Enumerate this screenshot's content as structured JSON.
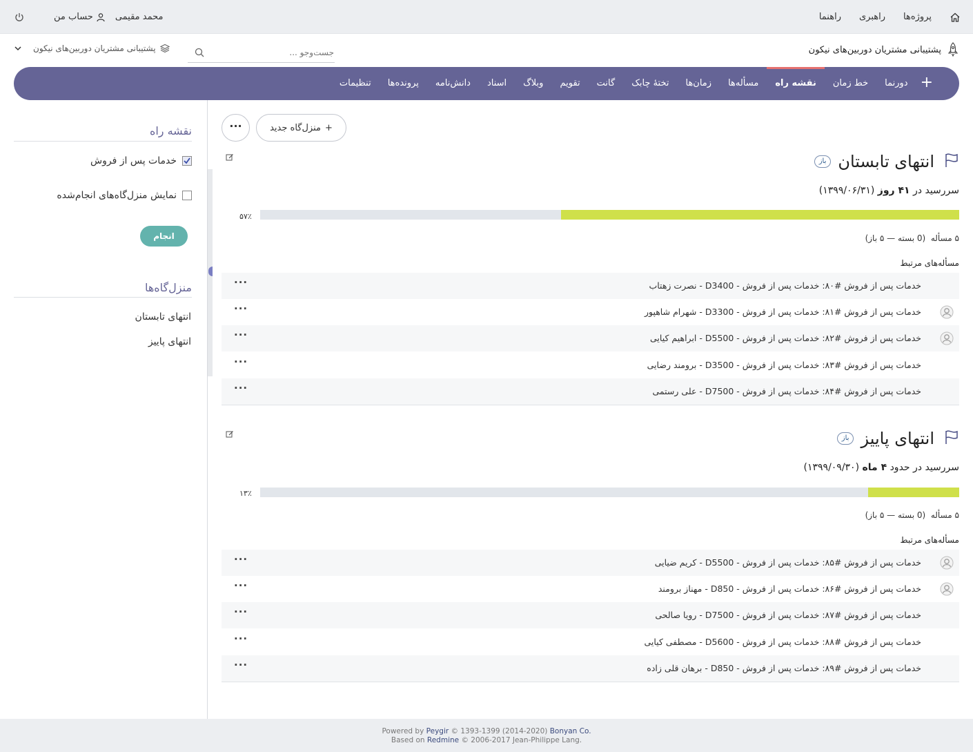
{
  "topbar": {
    "nav": [
      "پروژه‌ها",
      "راهبری",
      "راهنما"
    ],
    "user_name": "محمد مقیمی",
    "my_account": "حساب من"
  },
  "project": {
    "title": "پشتیبانی مشتریان دوربین‌های نیکون"
  },
  "search": {
    "placeholder": "جست‌وجو ..."
  },
  "project_jump": {
    "label": "پشتیبانی مشتریان دوربین‌های نیکون"
  },
  "menu": {
    "tabs": [
      "دورنما",
      "خط زمان",
      "نقشه راه",
      "مسأله‌ها",
      "زمان‌ها",
      "تختهٔ چابک",
      "گانت",
      "تقویم",
      "وبلاگ",
      "اسناد",
      "دانش‌نامه",
      "پرونده‌ها",
      "تنظیمات"
    ],
    "selected": "نقشه راه"
  },
  "sidebar": {
    "title": "نقشه راه",
    "tracker_label": "خدمات پس از فروش",
    "show_completed_label": "نمایش منزل‌گاه‌های انجام‌شده",
    "apply_label": "انجام",
    "milestones_title": "منزل‌گاه‌ها",
    "milestone_links": [
      "انتهای تابستان",
      "انتهای پاییز"
    ]
  },
  "toolbar": {
    "new_version_label": "منزل‌گاه جدید",
    "more_label": "···"
  },
  "versions": [
    {
      "name": "انتهای تابستان",
      "status": "باز",
      "due_prefix": "سررسید در ",
      "due_bold": "۴۱ روز",
      "due_date": " (۱۳۹۹/۰۶/۳۱)",
      "percent": 57,
      "percent_label": "۵۷٪",
      "issue_count": "۵ مسأله",
      "issue_breakdown": "(0 بسته — ۵ باز)",
      "related_label": "مسأله‌های مرتبط",
      "issues": [
        {
          "text": "خدمات پس از فروش #۸۰: خدمات پس از فروش - D3400 - نصرت زهتاب",
          "avatar": false
        },
        {
          "text": "خدمات پس از فروش #۸۱: خدمات پس از فروش - D3300 - شهرام شاهپور",
          "avatar": true
        },
        {
          "text": "خدمات پس از فروش #۸۲: خدمات پس از فروش - D5500 - ابراهیم کیایی",
          "avatar": true
        },
        {
          "text": "خدمات پس از فروش #۸۳: خدمات پس از فروش - D3500 - برومند رضایی",
          "avatar": false
        },
        {
          "text": "خدمات پس از فروش #۸۴: خدمات پس از فروش - D7500 - علی رستمی",
          "avatar": false
        }
      ]
    },
    {
      "name": "انتهای پاییز",
      "status": "باز",
      "due_prefix": "سررسید در حدود ",
      "due_bold": "۴ ماه",
      "due_date": " (۱۳۹۹/۰۹/۳۰)",
      "percent": 13,
      "percent_label": "۱۳٪",
      "issue_count": "۵ مسأله",
      "issue_breakdown": "(0 بسته — ۵ باز)",
      "related_label": "مسأله‌های مرتبط",
      "issues": [
        {
          "text": "خدمات پس از فروش #۸۵: خدمات پس از فروش - D5500 - کریم ضیایی",
          "avatar": true
        },
        {
          "text": "خدمات پس از فروش #۸۶: خدمات پس از فروش - D850 - مهناز برومند",
          "avatar": true
        },
        {
          "text": "خدمات پس از فروش #۸۷: خدمات پس از فروش - D7500 - رویا صالحی",
          "avatar": false
        },
        {
          "text": "خدمات پس از فروش #۸۸: خدمات پس از فروش - D5600 - مصطفی کیایی",
          "avatar": false
        },
        {
          "text": "خدمات پس از فروش #۸۹: خدمات پس از فروش - D850 - برهان قلی زاده",
          "avatar": false
        }
      ]
    }
  ],
  "footer": {
    "line1_a": "Powered by ",
    "line1_link": "Peygir",
    "line1_b": " © 1393-1399 (2014-2020) ",
    "line1_link2": "Bonyan Co.",
    "line2_a": "Based on ",
    "line2_link": "Redmine",
    "line2_b": " © 2006-2017 Jean-Philippe Lang."
  },
  "colors": {
    "menu_bg": "#656496",
    "menu_selected_indicator": "#e6716f",
    "progress_done": "#cfe04a",
    "progress_todo": "#e2e6eb",
    "apply_button": "#63b3ad"
  }
}
